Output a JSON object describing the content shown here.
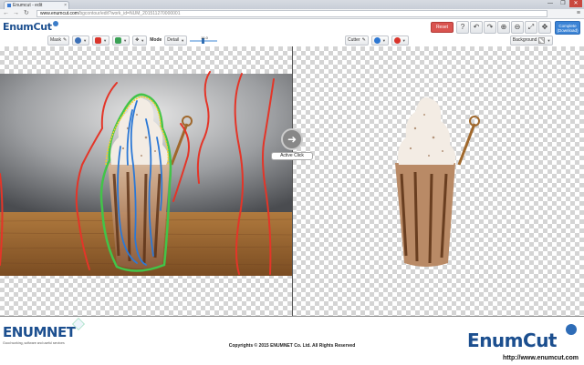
{
  "browser": {
    "tab_title": "Enumcut - edit",
    "tab_close": "×",
    "window_controls": [
      "—",
      "❐",
      "✕"
    ],
    "url_host": "www.enumcut.com",
    "url_path": "/bgcontour/edit?work_id=NUM_201511270000001",
    "back": "←",
    "forward": "→",
    "reload": "↻",
    "menu": "≡"
  },
  "app": {
    "logo": "EnumCut",
    "reset_label": "Reset",
    "tools": [
      "?",
      "↶",
      "↷",
      "⊕",
      "⊖",
      "⤢",
      "✥"
    ],
    "complete_label": "Complete",
    "complete_sub": "(Download)"
  },
  "left_toolbar": {
    "mask_label": "Mask",
    "mode_label": "Mode",
    "mode_value": "Detail",
    "slider_value": "16.0",
    "swatches": {
      "brush": "#3b6fb6",
      "remove": "#d9342b",
      "add": "#3aa155"
    }
  },
  "right_toolbar": {
    "cutter_label": "Cutter",
    "background_label": "Background",
    "swatches": {
      "add": "#2d77d2",
      "remove": "#d9342b"
    }
  },
  "canvas": {
    "active_click_label": "Active Click",
    "active_click_arrow": "➜"
  },
  "footer": {
    "logo_left": "ENUMNET",
    "tagline": "Good working, software and useful services",
    "copyright": "Copyrights © 2015 ENUMNET Co. Ltd. All Rights Reserved",
    "logo_right": "EnumCut",
    "site": "http://www.enumcut.com"
  }
}
